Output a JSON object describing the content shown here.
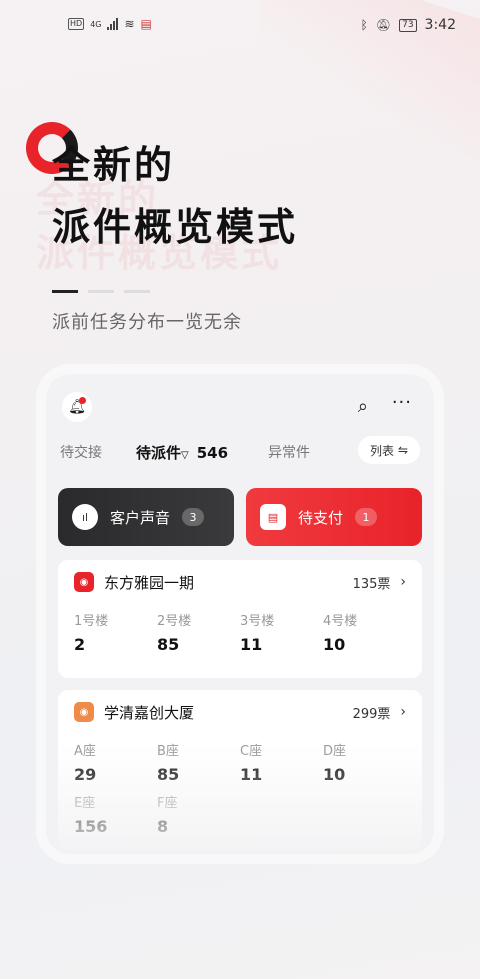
{
  "status_bar": {
    "left_hd": "HD",
    "network": "4G",
    "battery": "73",
    "time": "3:42"
  },
  "hero": {
    "title_line1": "全新的",
    "title_line2": "派件概览模式",
    "subtitle": "派前任务分布一览无余"
  },
  "app": {
    "tabs": [
      {
        "label": "待交接"
      },
      {
        "label": "待派件",
        "count": "546"
      },
      {
        "label": "异常件"
      }
    ],
    "list_button": "列表",
    "actions": [
      {
        "label": "客户声音",
        "badge": "3"
      },
      {
        "label": "待支付",
        "badge": "1"
      }
    ],
    "cards": [
      {
        "name": "东方雅园一期",
        "tickets": "135票",
        "cells": [
          {
            "label": "1号楼",
            "value": "2"
          },
          {
            "label": "2号楼",
            "value": "85"
          },
          {
            "label": "3号楼",
            "value": "11"
          },
          {
            "label": "4号楼",
            "value": "10"
          }
        ]
      },
      {
        "name": "学清嘉创大厦",
        "tickets": "299票",
        "cells": [
          {
            "label": "A座",
            "value": "29"
          },
          {
            "label": "B座",
            "value": "85"
          },
          {
            "label": "C座",
            "value": "11"
          },
          {
            "label": "D座",
            "value": "10"
          },
          {
            "label": "E座",
            "value": "156"
          },
          {
            "label": "F座",
            "value": "8"
          }
        ]
      }
    ]
  },
  "colors": {
    "brand_red": "#e8232a",
    "dark": "#2a2a2c"
  }
}
